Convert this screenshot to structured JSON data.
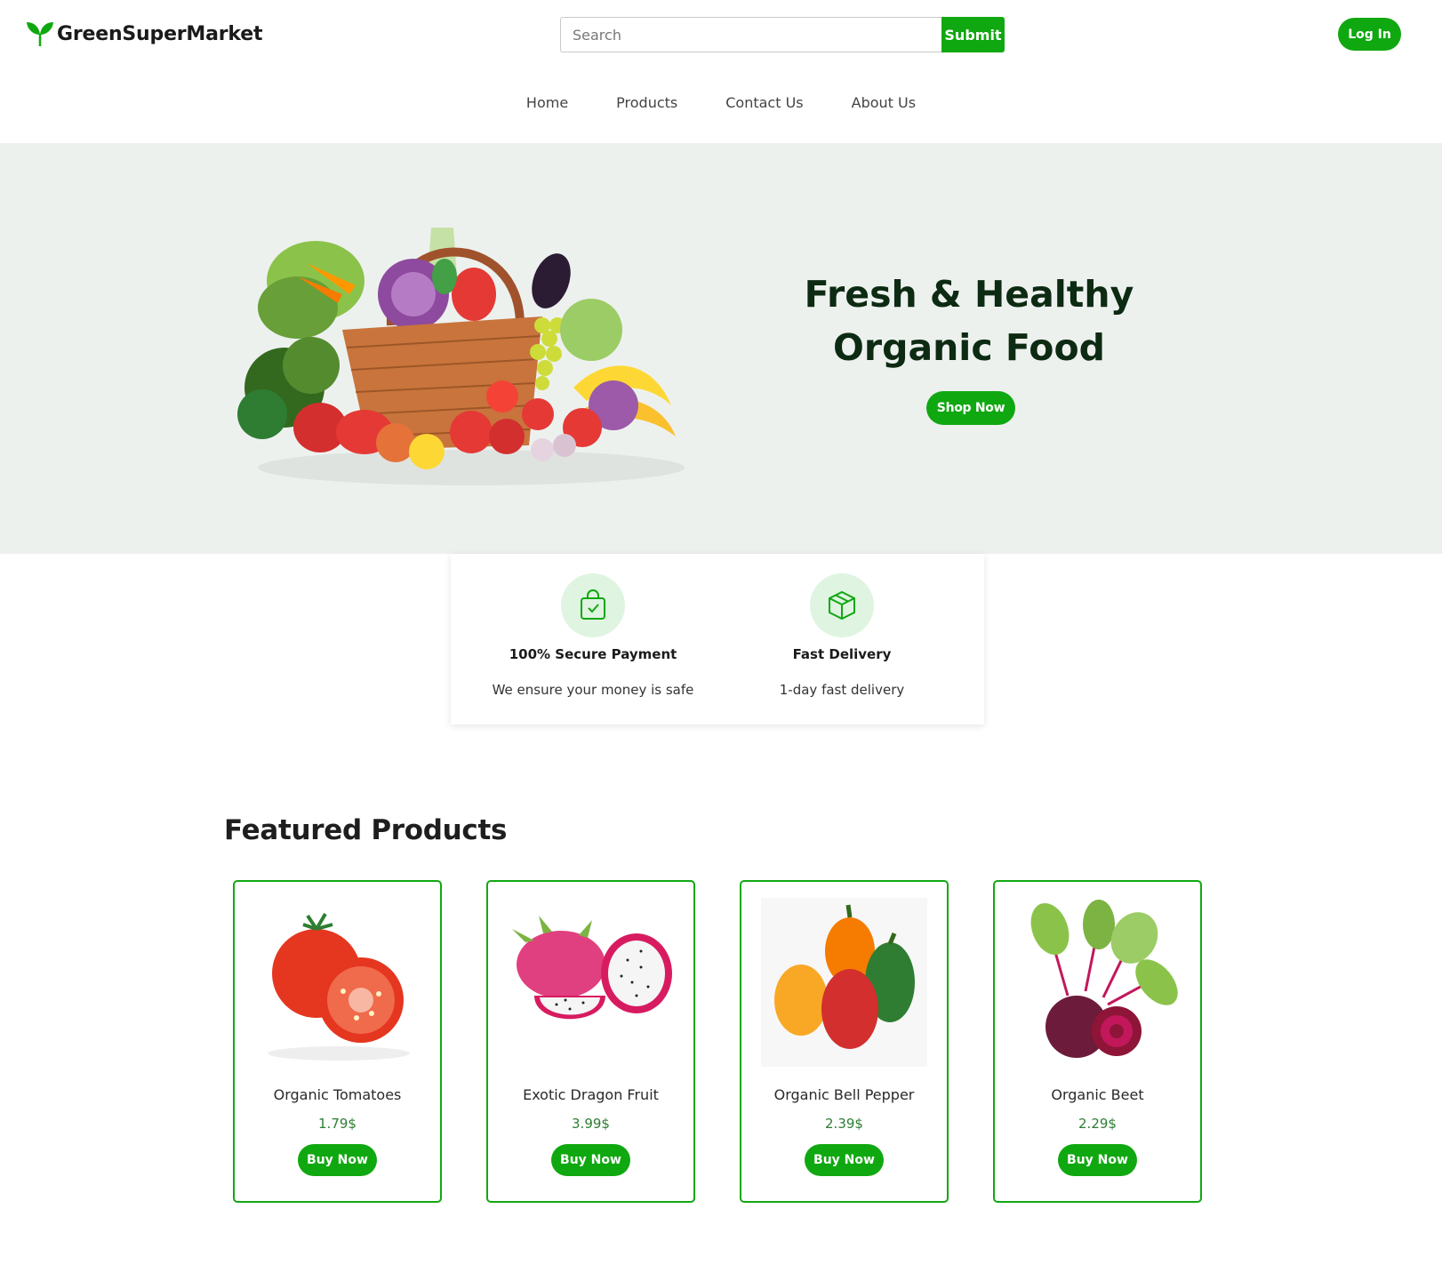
{
  "brand": {
    "name": "GreenSuperMarket",
    "accent": "#10a810",
    "icon": "leaf-logo-icon"
  },
  "search": {
    "placeholder": "Search",
    "value": "",
    "submit_label": "Submit"
  },
  "auth": {
    "login_label": "Log In"
  },
  "nav": {
    "items": [
      "Home",
      "Products",
      "Contact Us",
      "About Us"
    ]
  },
  "hero": {
    "title_line1": "Fresh & Healthy",
    "title_line2": "Organic Food",
    "cta_label": "Shop Now",
    "image": "vegetable-basket-image",
    "background": "#edf1ee"
  },
  "features": [
    {
      "icon": "shopping-bag-check-icon",
      "title": "100% Secure Payment",
      "desc": "We ensure your money is safe"
    },
    {
      "icon": "box-package-icon",
      "title": "Fast Delivery",
      "desc": "1-day fast delivery"
    }
  ],
  "featured": {
    "title": "Featured Products",
    "products": [
      {
        "name": "Organic Tomatoes",
        "price": "1.79$",
        "button": "Buy Now",
        "image": "tomato-image"
      },
      {
        "name": "Exotic Dragon Fruit",
        "price": "3.99$",
        "button": "Buy Now",
        "image": "dragon-fruit-image"
      },
      {
        "name": "Organic Bell Pepper",
        "price": "2.39$",
        "button": "Buy Now",
        "image": "bell-pepper-image"
      },
      {
        "name": "Organic Beet",
        "price": "2.29$",
        "button": "Buy Now",
        "image": "beet-image"
      }
    ]
  }
}
